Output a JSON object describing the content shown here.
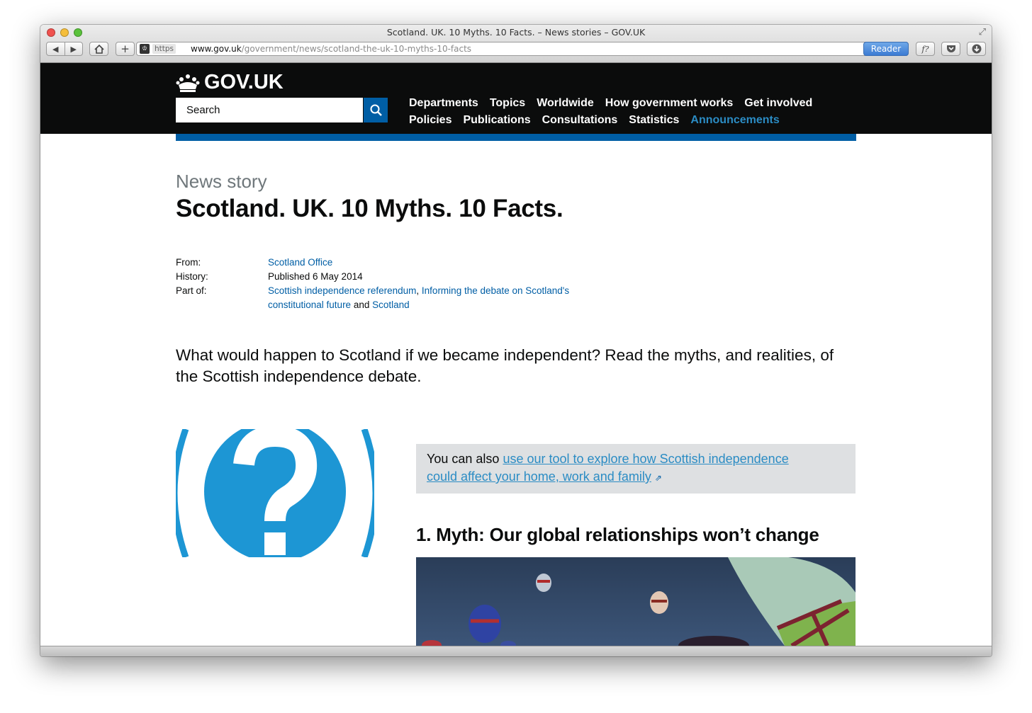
{
  "window": {
    "title": "Scotland. UK. 10 Myths. 10 Facts. – News stories – GOV.UK"
  },
  "toolbar": {
    "back_icon": "back-arrow-icon",
    "forward_icon": "forward-arrow-icon",
    "home_icon": "home-icon",
    "new_tab_icon": "plus-icon",
    "https_label": "https",
    "url_host": "www.gov.uk",
    "url_path": "/government/news/scotland-the-uk-10-myths-10-facts",
    "reader_label": "Reader",
    "ext_buttons": [
      "f?-icon",
      "pocket-icon",
      "download-icon"
    ]
  },
  "govuk": {
    "logo_text": "GOV.UK",
    "search_placeholder": "Search",
    "nav_row1": [
      "Departments",
      "Topics",
      "Worldwide",
      "How government works",
      "Get involved"
    ],
    "nav_row2": [
      "Policies",
      "Publications",
      "Consultations",
      "Statistics",
      "Announcements"
    ],
    "active_nav": "Announcements",
    "brand_color": "#005ea5",
    "link_color": "#2b8cc4"
  },
  "article": {
    "doc_type": "News story",
    "title": "Scotland. UK. 10 Myths. 10 Facts.",
    "meta": {
      "from_label": "From:",
      "from_value": "Scotland Office",
      "history_label": "History:",
      "history_value": "Published 6 May 2014",
      "part_of_label": "Part of:",
      "part_of_link1": "Scottish independence referendum",
      "part_of_sep": ",",
      "part_of_link2a": "Informing the debate on Scotland's",
      "part_of_link2b": "constitutional future",
      "part_of_and": "and",
      "part_of_link3": "Scotland"
    },
    "lead": "What would happen to Scotland if we became independent? Read the myths, and realities, of the Scottish independence debate.",
    "callout": {
      "prefix": "You can also",
      "link_line1": "use our tool to explore how Scottish independence",
      "link_line2": "could affect your home, work and family"
    },
    "section_heading": "1. Myth: Our global relationships won’t change"
  }
}
